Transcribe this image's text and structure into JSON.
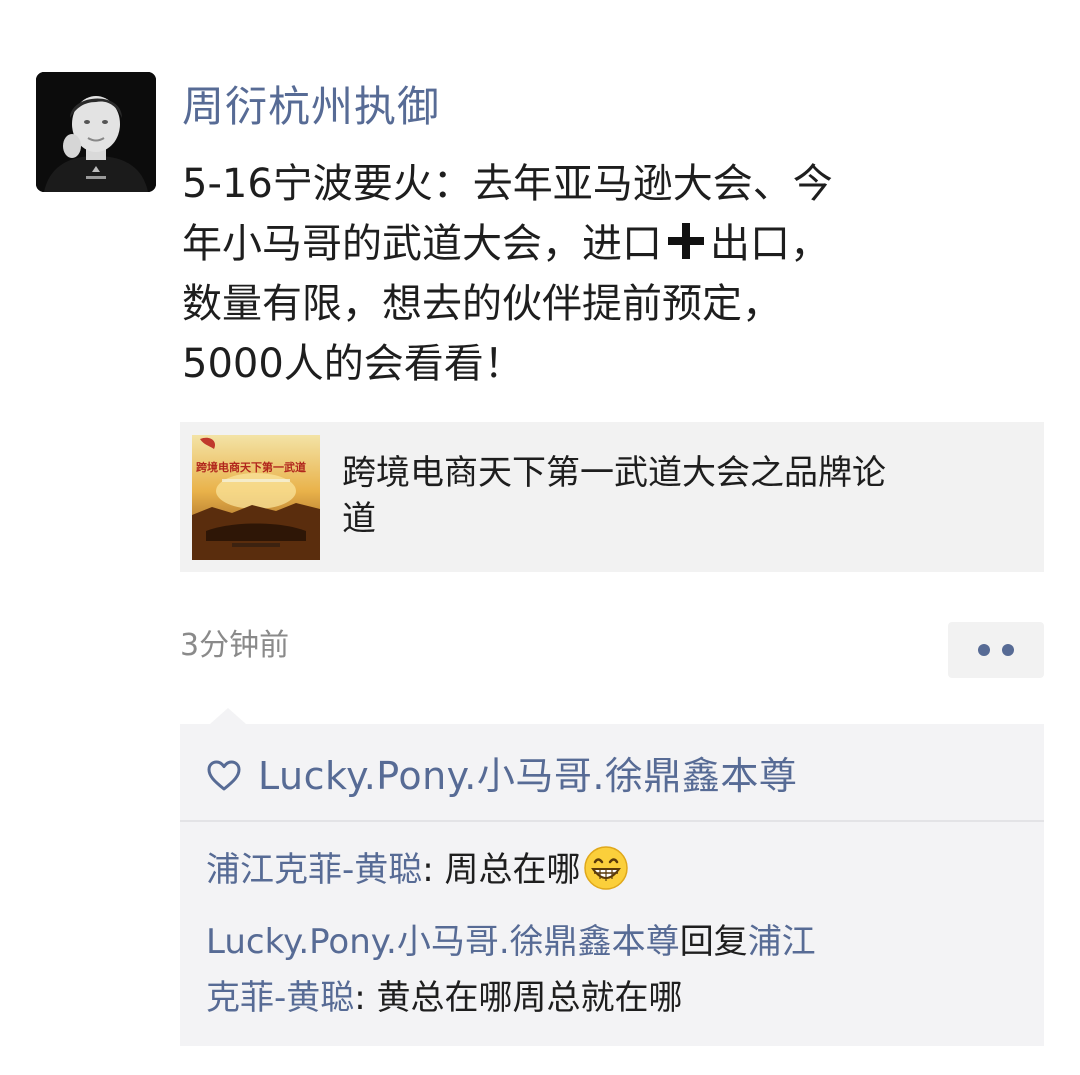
{
  "post": {
    "author": "周衍杭州执御",
    "text_lines": [
      "5-16宁波要火：去年亚马逊大会、今",
      "年小马哥的武道大会，进口",
      "出口，",
      "数量有限，想去的伙伴提前预定，",
      "5000人的会看看！"
    ],
    "plus_icon": "heavy-plus-icon",
    "link_card": {
      "title_lines": [
        "跨境电商天下第一武道大会之品牌论",
        "道"
      ],
      "thumbnail_caption": "跨境电商天下第一武道"
    },
    "timestamp": "3分钟前",
    "more_icon": "two-dots-icon"
  },
  "interactions": {
    "likes": {
      "icon": "heart-outline-icon",
      "names": "Lucky.Pony.小马哥.徐鼎鑫本尊"
    },
    "comments": [
      {
        "author": "浦江克菲-黄聪",
        "separator": ": ",
        "text": "周总在哪",
        "emoji": "grinning-face-emoji"
      },
      {
        "author": "Lucky.Pony.小马哥.徐鼎鑫本尊",
        "reply_word": "回复",
        "reply_to_part1": "浦江",
        "reply_to_part2": "克菲-黄聪",
        "separator": ": ",
        "text": "黄总在哪周总就在哪"
      }
    ]
  },
  "colors": {
    "link_blue": "#576b95",
    "text": "#1e1e1e",
    "timestamp": "#8a8a8a",
    "card_bg": "#f2f2f2",
    "comment_bg": "#f3f3f5"
  }
}
